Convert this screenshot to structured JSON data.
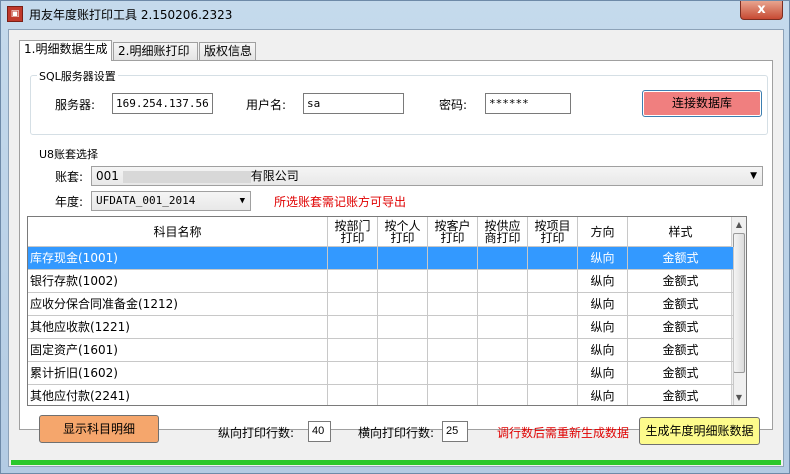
{
  "window": {
    "title": "用友年度账打印工具 2.150206.2323",
    "close_label": "x"
  },
  "tabs": [
    "1.明细数据生成",
    "2.明细账打印",
    "版权信息"
  ],
  "sql_group": {
    "legend": "SQL服务器设置",
    "server_label": "服务器:",
    "server_value": "169.254.137.56",
    "user_label": "用户名:",
    "user_value": "sa",
    "password_label": "密码:",
    "password_value": "******",
    "connect_button": "连接数据库"
  },
  "u8_group": {
    "legend": "U8账套选择",
    "account_label": "账套:",
    "account_value": "001 ",
    "account_suffix": "有限公司",
    "year_label": "年度:",
    "year_value": "UFDATA_001_2014",
    "notice": "所选账套需记账方可导出"
  },
  "grid": {
    "columns": [
      "科目名称",
      "按部门\n打印",
      "按个人\n打印",
      "按客户\n打印",
      "按供应\n商打印",
      "按项目\n打印",
      "方向",
      "样式"
    ],
    "rows": [
      {
        "name": "库存现金(1001)",
        "direction": "纵向",
        "style": "金额式",
        "selected": true
      },
      {
        "name": "银行存款(1002)",
        "direction": "纵向",
        "style": "金额式"
      },
      {
        "name": "应收分保合同准备金(1212)",
        "direction": "纵向",
        "style": "金额式"
      },
      {
        "name": "其他应收款(1221)",
        "direction": "纵向",
        "style": "金额式"
      },
      {
        "name": "固定资产(1601)",
        "direction": "纵向",
        "style": "金额式"
      },
      {
        "name": "累计折旧(1602)",
        "direction": "纵向",
        "style": "金额式"
      },
      {
        "name": "其他应付款(2241)",
        "direction": "纵向",
        "style": "金额式"
      }
    ]
  },
  "footer": {
    "show_button": "显示科目明细",
    "vertical_rows_label": "纵向打印行数:",
    "vertical_rows_value": "40",
    "horizontal_rows_label": "横向打印行数:",
    "horizontal_rows_value": "25",
    "notice": "调行数后需重新生成数据",
    "generate_button": "生成年度明细账数据"
  },
  "colors": {
    "selected_row": "#3399ff",
    "notice": "#e00000",
    "connect_button": "#f07f7f",
    "show_button": "#f5a66c",
    "generate_button": "#fdfb8c",
    "progress": "#2bc82b"
  },
  "progress": 1.0
}
